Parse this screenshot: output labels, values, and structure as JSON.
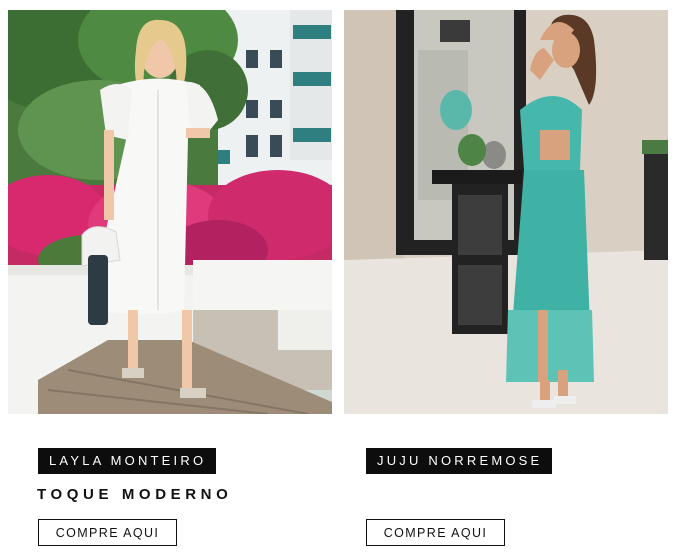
{
  "cards": [
    {
      "name_tag": "LAYLA MONTEIRO",
      "headline": "TOQUE MODERNO",
      "button_label": "COMPRE AQUI",
      "photo_subject": "woman in white eyelet midi dress with white bag, beside pink bougainvillea and white building",
      "colors": {
        "dress": "#f8f8f6",
        "flowers": "#d8286e",
        "foliage": "#3c6e34",
        "building": "#e9ecec",
        "railing": "#2f7f80"
      }
    },
    {
      "name_tag": "JUJU NORREMOSE",
      "headline": "",
      "button_label": "COMPRE AQUI",
      "photo_subject": "woman in turquoise tie-back maxi dress with eyelet hem, beside ornate black table and mirror",
      "colors": {
        "dress": "#46b8ab",
        "wall": "#d9cfc3",
        "floor": "#e9e4dd",
        "table": "#1b1b1b"
      }
    }
  ],
  "theme": {
    "tag_background": "#0d0d0d",
    "tag_text": "#ffffff",
    "button_border": "#111111"
  }
}
